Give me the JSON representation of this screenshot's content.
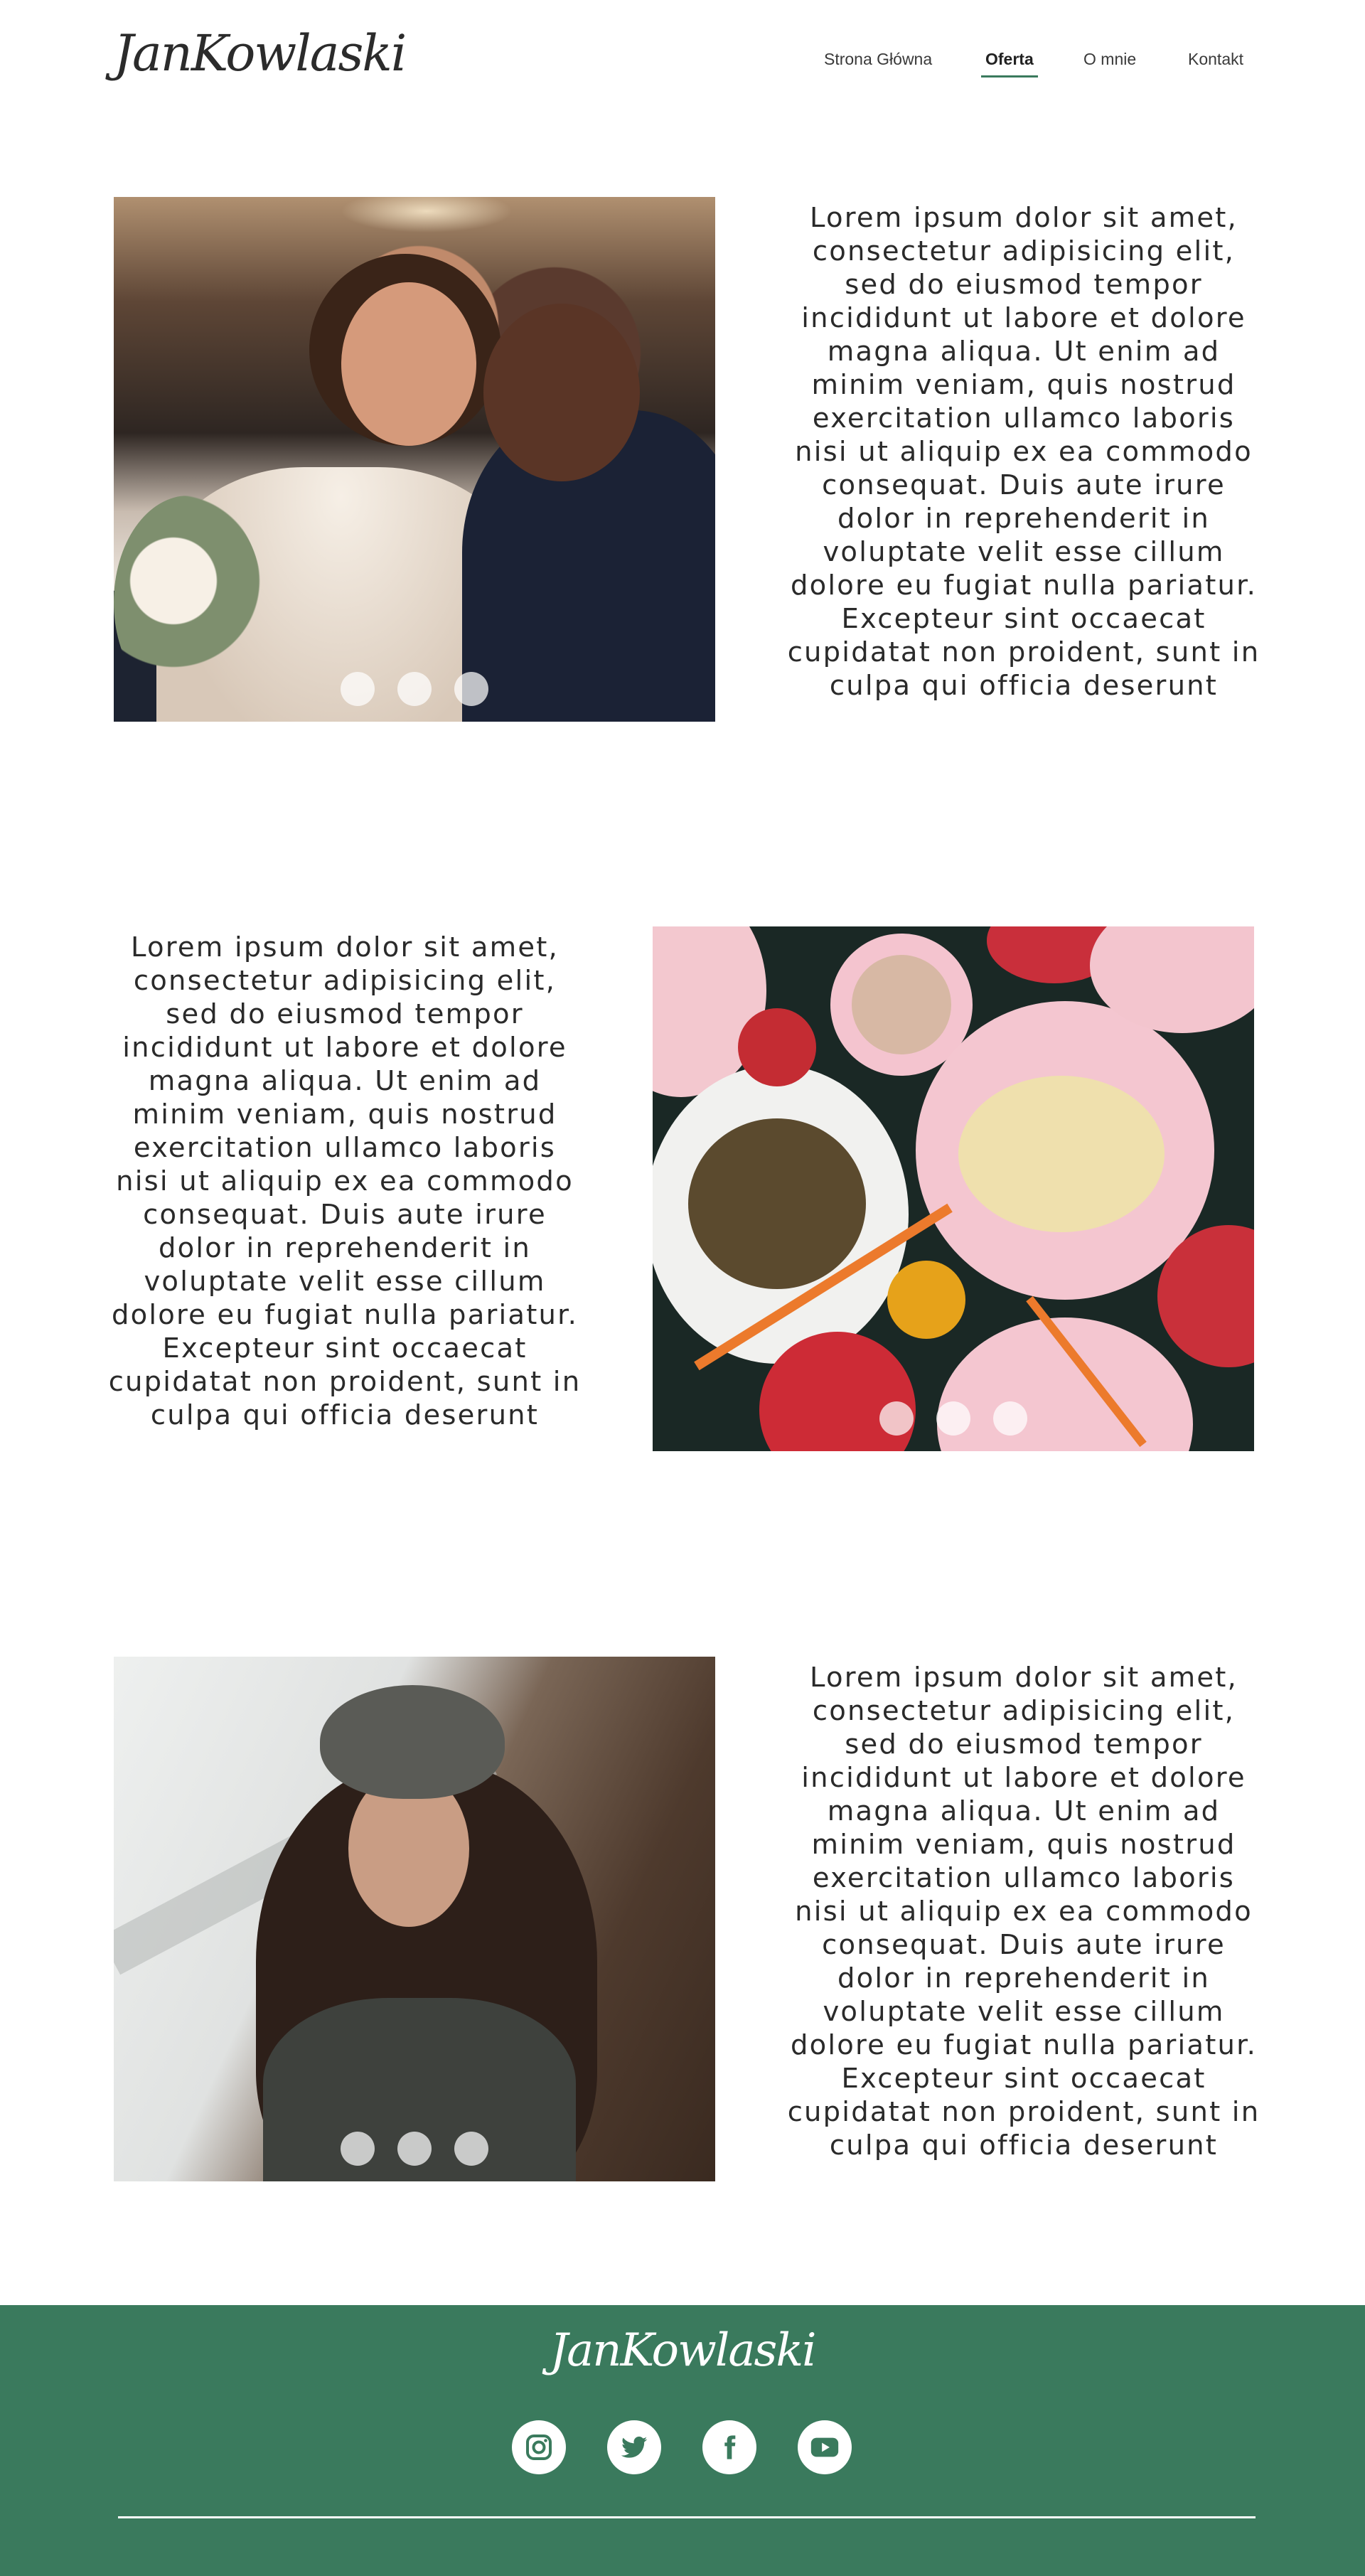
{
  "header": {
    "logo_text": "JanKowlaski",
    "nav": [
      {
        "label": "Strona Główna",
        "active": false
      },
      {
        "label": "Oferta",
        "active": true
      },
      {
        "label": "O mnie",
        "active": false
      },
      {
        "label": "Kontakt",
        "active": false
      }
    ]
  },
  "sections": [
    {
      "text": "Lorem ipsum dolor sit amet, consectetur adipisicing elit, sed do eiusmod tempor incididunt ut labore et dolore magna aliqua. Ut enim ad minim veniam, quis nostrud exercitation ullamco laboris nisi ut aliquip ex ea commodo consequat. Duis aute irure dolor in reprehenderit in voluptate velit esse cillum dolore eu fugiat nulla pariatur. Excepteur sint occaecat cupidatat non proident, sunt in culpa qui officia deserunt",
      "image": "wedding-couple-photo",
      "slider_dots": 3
    },
    {
      "text": "Lorem ipsum dolor sit amet, consectetur adipisicing elit, sed do eiusmod tempor incididunt ut labore et dolore magna aliqua. Ut enim ad minim veniam, quis nostrud exercitation ullamco laboris nisi ut aliquip ex ea commodo consequat. Duis aute irure dolor in reprehenderit in voluptate velit esse cillum dolore eu fugiat nulla pariatur. Excepteur sint occaecat cupidatat non proident, sunt in culpa qui officia deserunt",
      "image": "food-table-photo",
      "slider_dots": 3
    },
    {
      "text": "Lorem ipsum dolor sit amet, consectetur adipisicing elit, sed do eiusmod tempor incididunt ut labore et dolore magna aliqua. Ut enim ad minim veniam, quis nostrud exercitation ullamco laboris nisi ut aliquip ex ea commodo consequat. Duis aute irure dolor in reprehenderit in voluptate velit esse cillum dolore eu fugiat nulla pariatur. Excepteur sint occaecat cupidatat non proident, sunt in culpa qui officia deserunt",
      "image": "woman-portrait-photo",
      "slider_dots": 3
    }
  ],
  "footer": {
    "logo_text": "JanKowlaski",
    "socials": [
      "instagram-icon",
      "twitter-icon",
      "facebook-icon",
      "youtube-icon"
    ],
    "background_color": "#3a7a5d"
  },
  "colors": {
    "accent": "#3a7a5d",
    "text": "#2a2a2a"
  }
}
